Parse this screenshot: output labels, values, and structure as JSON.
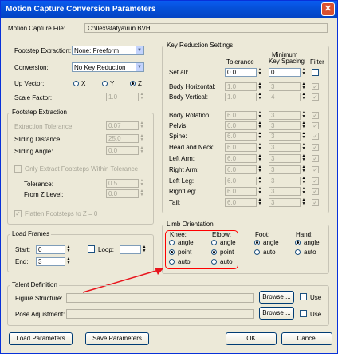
{
  "window": {
    "title": "Motion Capture Conversion Parameters",
    "close_glyph": "✕"
  },
  "file": {
    "label": "Motion Capture File:",
    "value": "C:\\Ilex\\statya\\run.BVH"
  },
  "left": {
    "footstep_extraction": {
      "label": "Footstep Extraction:",
      "value": "None: Freeform"
    },
    "conversion": {
      "label": "Conversion:",
      "value": "No Key Reduction"
    },
    "up_vector": {
      "label": "Up Vector:",
      "x": "X",
      "y": "Y",
      "z": "Z",
      "selected": "Z"
    },
    "scale_factor": {
      "label": "Scale Factor:",
      "value": "1.0"
    }
  },
  "footstep_group": {
    "title": "Footstep Extraction",
    "extraction_tolerance": {
      "label": "Extraction Tolerance:",
      "value": "0.07"
    },
    "sliding_distance": {
      "label": "Sliding Distance:",
      "value": "25.0"
    },
    "sliding_angle": {
      "label": "Sliding Angle:",
      "value": "0.0"
    },
    "only_extract": {
      "label": "Only Extract Footsteps Within Tolerance",
      "checked": false
    },
    "tolerance": {
      "label": "Tolerance:",
      "value": "0.5"
    },
    "from_z": {
      "label": "From Z Level:",
      "value": "0.0"
    },
    "flatten": {
      "label": "Flatten Footsteps to Z = 0",
      "checked": true
    }
  },
  "key_reduction": {
    "title": "Key Reduction Settings",
    "col_tolerance": "Tolerance",
    "col_min_spacing_1": "Minimum",
    "col_min_spacing_2": "Key Spacing",
    "col_filter": "Filter",
    "rows": [
      {
        "label": "Set all:",
        "tol": "0.0",
        "min": "0",
        "filter": false
      },
      {
        "label": "Body Horizontal:",
        "tol": "1.0",
        "min": "3",
        "filter": true
      },
      {
        "label": "Body Vertical:",
        "tol": "1.0",
        "min": "4",
        "filter": true
      },
      {
        "label": "Body Rotation:",
        "tol": "6.0",
        "min": "3",
        "filter": true
      },
      {
        "label": "Pelvis:",
        "tol": "6.0",
        "min": "3",
        "filter": true
      },
      {
        "label": "Spine:",
        "tol": "6.0",
        "min": "3",
        "filter": true
      },
      {
        "label": "Head and Neck:",
        "tol": "6.0",
        "min": "3",
        "filter": true
      },
      {
        "label": "Left Arm:",
        "tol": "6.0",
        "min": "3",
        "filter": true
      },
      {
        "label": "Right Arm:",
        "tol": "6.0",
        "min": "3",
        "filter": true
      },
      {
        "label": "Left Leg:",
        "tol": "6.0",
        "min": "3",
        "filter": true
      },
      {
        "label": "RightLeg:",
        "tol": "6.0",
        "min": "3",
        "filter": true
      },
      {
        "label": "Tail:",
        "tol": "6.0",
        "min": "3",
        "filter": true
      }
    ]
  },
  "load_frames": {
    "title": "Load Frames",
    "start_label": "Start:",
    "start": "0",
    "end_label": "End:",
    "end": "3",
    "loop_label": "Loop:",
    "loop_checked": false,
    "loop_value": ""
  },
  "limb": {
    "title": "Limb Orientation",
    "knee": {
      "label": "Knee:",
      "options": [
        "angle",
        "point",
        "auto"
      ],
      "selected": "point"
    },
    "elbow": {
      "label": "Elbow:",
      "options": [
        "angle",
        "point",
        "auto"
      ],
      "selected": "point"
    },
    "foot": {
      "label": "Foot:",
      "options": [
        "angle",
        "auto"
      ],
      "selected": "angle"
    },
    "hand": {
      "label": "Hand:",
      "options": [
        "angle",
        "auto"
      ],
      "selected": "angle"
    }
  },
  "talent": {
    "title": "Talent Definition",
    "figure_label": "Figure Structure:",
    "pose_label": "Pose Adjustment:",
    "browse": "Browse ...",
    "use": "Use",
    "figure_use": false,
    "pose_use": false
  },
  "buttons": {
    "load": "Load Parameters",
    "save": "Save Parameters",
    "ok": "OK",
    "cancel": "Cancel"
  },
  "colors": {
    "title_bar": "#0550d8",
    "dialog_bg": "#ece9d8",
    "highlight": "#ff0000"
  }
}
